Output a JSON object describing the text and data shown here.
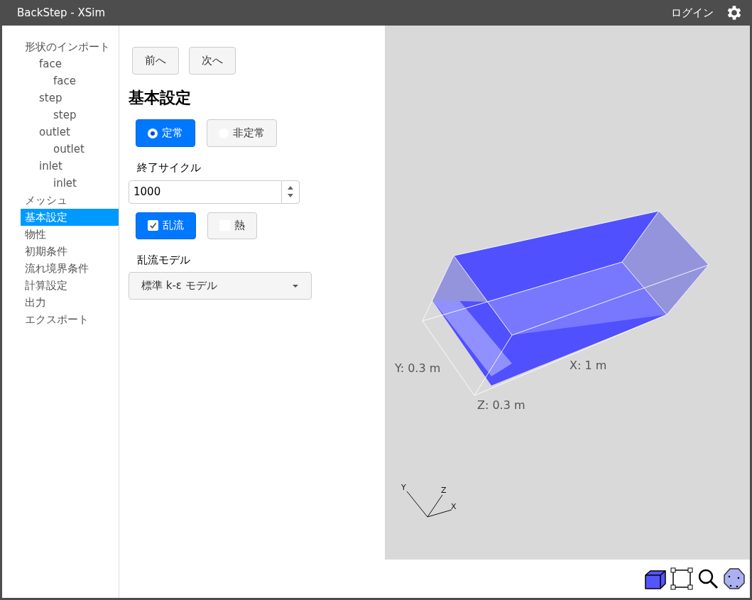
{
  "window": {
    "title": "BackStep - XSim",
    "login": "ログイン"
  },
  "sidebar": {
    "items": [
      {
        "label": "形状のインポート",
        "selected": false,
        "children": [
          {
            "label": "face",
            "selected": false,
            "children": [
              {
                "label": "face",
                "selected": false
              }
            ]
          },
          {
            "label": "step",
            "selected": false,
            "children": [
              {
                "label": "step",
                "selected": false
              }
            ]
          },
          {
            "label": "outlet",
            "selected": false,
            "children": [
              {
                "label": "outlet",
                "selected": false
              }
            ]
          },
          {
            "label": "inlet",
            "selected": false,
            "children": [
              {
                "label": "inlet",
                "selected": false
              }
            ]
          }
        ]
      },
      {
        "label": "メッシュ",
        "selected": false
      },
      {
        "label": "基本設定",
        "selected": true
      },
      {
        "label": "物性",
        "selected": false
      },
      {
        "label": "初期条件",
        "selected": false
      },
      {
        "label": "流れ境界条件",
        "selected": false
      },
      {
        "label": "計算設定",
        "selected": false
      },
      {
        "label": "出力",
        "selected": false
      },
      {
        "label": "エクスポート",
        "selected": false
      }
    ]
  },
  "nav_buttons": [
    "前へ",
    "次へ"
  ],
  "form": {
    "heading": "基本設定",
    "time_mode": [
      {
        "label": "定常",
        "selected": true
      },
      {
        "label": "非定常",
        "selected": false
      }
    ],
    "end_cycle": {
      "label": "終了サイクル",
      "value": "1000"
    },
    "options": [
      {
        "label": "乱流",
        "checked": true
      },
      {
        "label": "熱",
        "checked": false
      }
    ],
    "turbulence_model": {
      "label": "乱流モデル",
      "value": "標準 k-ε モデル"
    }
  },
  "viewer": {
    "dimension_labels": [
      {
        "kind": "y",
        "text": "Y: 0.3 m"
      },
      {
        "kind": "z",
        "text": "Z: 0.3 m"
      },
      {
        "kind": "x",
        "text": "X: 1 m"
      }
    ],
    "axis_labels": [
      {
        "kind": "y",
        "text": "Y"
      },
      {
        "kind": "z",
        "text": "Z"
      },
      {
        "kind": "x",
        "text": "X"
      }
    ]
  }
}
